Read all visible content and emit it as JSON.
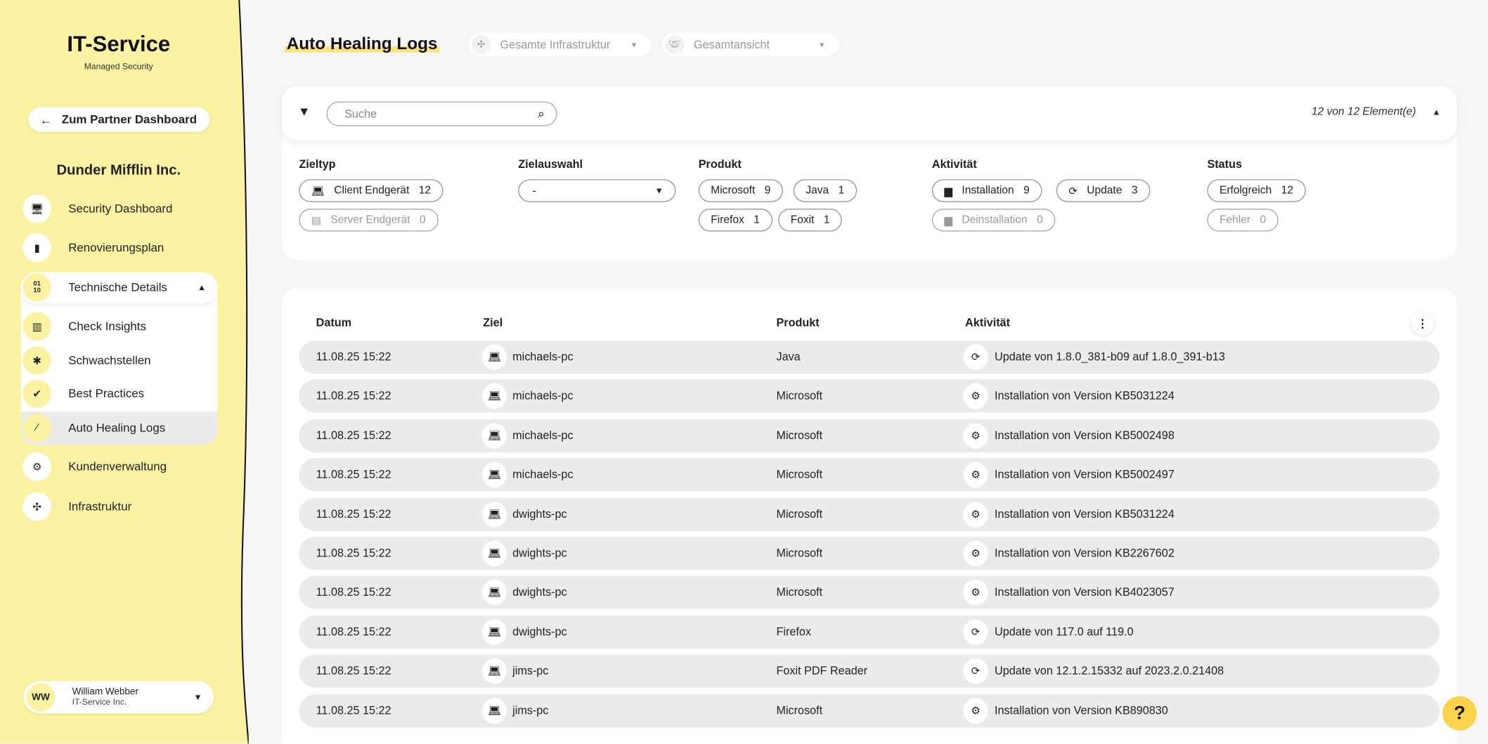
{
  "sidebar": {
    "brand_title": "IT-Service",
    "brand_subtitle": "Managed Security",
    "back_button": "Zum Partner Dashboard",
    "org_name": "Dunder Mifflin Inc.",
    "items": [
      {
        "label": "Security Dashboard",
        "icon": "monitor-icon"
      },
      {
        "label": "Renovierungsplan",
        "icon": "clipboard-icon"
      },
      {
        "label": "Technische Details",
        "icon": "binary-icon"
      },
      {
        "label": "Check Insights",
        "icon": "barcode-icon"
      },
      {
        "label": "Schwachstellen",
        "icon": "bug-icon"
      },
      {
        "label": "Best Practices",
        "icon": "check-badge-icon"
      },
      {
        "label": "Auto Healing Logs",
        "icon": "magic-wand-icon",
        "active": true
      },
      {
        "label": "Kundenverwaltung",
        "icon": "gears-icon"
      },
      {
        "label": "Infrastruktur",
        "icon": "network-icon"
      }
    ],
    "binary_glyph": "01\n10",
    "user": {
      "initials": "WW",
      "name": "William Webber",
      "company": "IT-Service Inc."
    }
  },
  "header": {
    "title": "Auto Healing Logs",
    "infra_dropdown": "Gesamte Infrastruktur",
    "view_dropdown": "Gesamtansicht"
  },
  "filter": {
    "search_placeholder": "Suche",
    "count": "12 von 12 Element(e)",
    "zieltyp": {
      "label": "Zieltyp",
      "chips": [
        {
          "label": "Client Endgerät",
          "count": "12"
        },
        {
          "label": "Server Endgerät",
          "count": "0"
        }
      ]
    },
    "zielauswahl": {
      "label": "Zielauswahl",
      "value": "-"
    },
    "produkt": {
      "label": "Produkt",
      "chips": [
        {
          "label": "Microsoft",
          "count": "9"
        },
        {
          "label": "Java",
          "count": "1"
        },
        {
          "label": "Firefox",
          "count": "1"
        },
        {
          "label": "Foxit",
          "count": "1"
        }
      ]
    },
    "aktivitaet": {
      "label": "Aktivität",
      "chips": [
        {
          "label": "Installation",
          "count": "9"
        },
        {
          "label": "Update",
          "count": "3"
        },
        {
          "label": "Deinstallation",
          "count": "0"
        }
      ]
    },
    "status": {
      "label": "Status",
      "chips": [
        {
          "label": "Erfolgreich",
          "count": "12"
        },
        {
          "label": "Fehler",
          "count": "0"
        }
      ]
    }
  },
  "table": {
    "headers": [
      "Datum",
      "Ziel",
      "Produkt",
      "Aktivität"
    ],
    "rows": [
      {
        "date": "11.08.25  15:22",
        "target": "michaels-pc",
        "product": "Java",
        "type": "update",
        "activity": "Update von 1.8.0_381-b09 auf 1.8.0_391-b13"
      },
      {
        "date": "11.08.25  15:22",
        "target": "michaels-pc",
        "product": "Microsoft",
        "type": "install",
        "activity": "Installation von Version KB5031224"
      },
      {
        "date": "11.08.25  15:22",
        "target": "michaels-pc",
        "product": "Microsoft",
        "type": "install",
        "activity": "Installation von Version KB5002498"
      },
      {
        "date": "11.08.25  15:22",
        "target": "michaels-pc",
        "product": "Microsoft",
        "type": "install",
        "activity": "Installation von Version KB5002497"
      },
      {
        "date": "11.08.25  15:22",
        "target": "dwights-pc",
        "product": "Microsoft",
        "type": "install",
        "activity": "Installation von Version KB5031224"
      },
      {
        "date": "11.08.25  15:22",
        "target": "dwights-pc",
        "product": "Microsoft",
        "type": "install",
        "activity": "Installation von Version KB2267602"
      },
      {
        "date": "11.08.25  15:22",
        "target": "dwights-pc",
        "product": "Microsoft",
        "type": "install",
        "activity": "Installation von Version KB4023057"
      },
      {
        "date": "11.08.25  15:22",
        "target": "dwights-pc",
        "product": "Firefox",
        "type": "update",
        "activity": "Update von 117.0 auf 119.0"
      },
      {
        "date": "11.08.25  15:22",
        "target": "jims-pc",
        "product": "Foxit PDF Reader",
        "type": "update",
        "activity": "Update von 12.1.2.15332 auf 2023.2.0.21408"
      },
      {
        "date": "11.08.25  15:22",
        "target": "jims-pc",
        "product": "Microsoft",
        "type": "install",
        "activity": "Installation von Version KB890830"
      }
    ]
  },
  "help_label": "?",
  "colors": {
    "sidebar_bg": "#fbf3a3",
    "accent": "#fcd34d",
    "row_bg": "#ebebeb"
  }
}
